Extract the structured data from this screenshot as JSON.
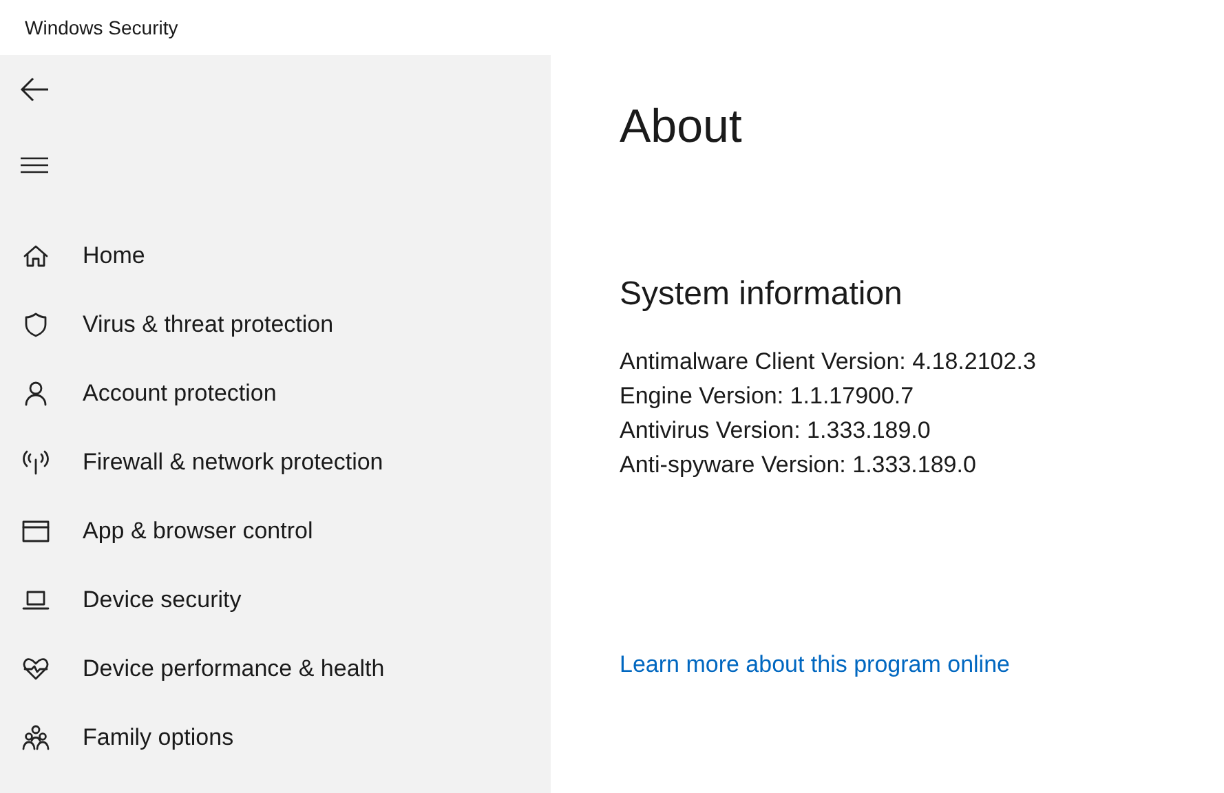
{
  "window": {
    "title": "Windows Security"
  },
  "sidebar": {
    "items": [
      {
        "kind": "home",
        "label": "Home"
      },
      {
        "kind": "shield",
        "label": "Virus & threat protection"
      },
      {
        "kind": "person",
        "label": "Account protection"
      },
      {
        "kind": "antenna",
        "label": "Firewall & network protection"
      },
      {
        "kind": "window",
        "label": "App & browser control"
      },
      {
        "kind": "laptop",
        "label": "Device security"
      },
      {
        "kind": "heart",
        "label": "Device performance & health"
      },
      {
        "kind": "family",
        "label": "Family options"
      }
    ]
  },
  "page": {
    "title": "About",
    "section_title": "System information",
    "info_lines": [
      "Antimalware Client Version: 4.18.2102.3",
      "Engine Version: 1.1.17900.7",
      "Antivirus Version: 1.333.189.0",
      "Anti-spyware Version: 1.333.189.0"
    ],
    "link": "Learn more about this program online"
  }
}
